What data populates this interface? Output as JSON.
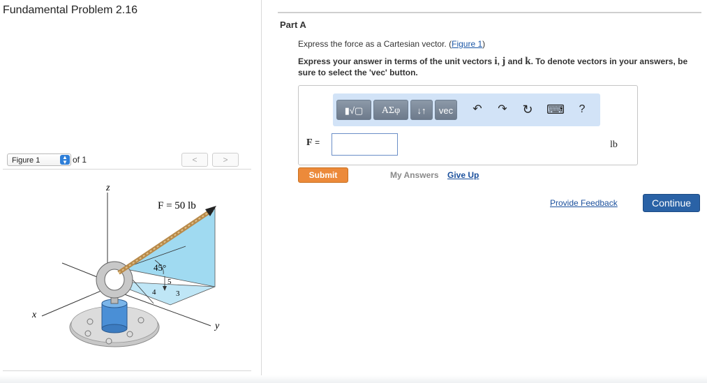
{
  "problem": {
    "title": "Fundamental Problem 2.16"
  },
  "figure_nav": {
    "select_value": "Figure 1",
    "of_label": "of 1",
    "prev": "<",
    "next": ">",
    "labels": {
      "z": "z",
      "x": "x",
      "y": "y",
      "force": "F = 50 lb",
      "angle": "45°",
      "n5": "5",
      "n4": "4",
      "n3": "3"
    }
  },
  "part": {
    "title": "Part A",
    "prompt_text": "Express the force as a Cartesian vector. (",
    "prompt_link": "Figure 1",
    "prompt_end": ")",
    "instr_pre": "Express your answer in terms of the unit vectors ",
    "unit_i": "i",
    "sep_comma": ", ",
    "unit_j": "j",
    "sep_and": " and ",
    "unit_k": "k",
    "instr_post": ". To denote vectors in your answers, be sure to select the 'vec' button."
  },
  "toolbar": {
    "templates": "▮√▢",
    "greek": "ΑΣφ",
    "arrows": "↓↑",
    "vec": "vec",
    "undo": "↶",
    "redo": "↷",
    "reset": "↻",
    "keyboard": "⌨",
    "help": "?"
  },
  "answer": {
    "label": "F",
    "equals": "=",
    "value": "",
    "unit": "lb"
  },
  "actions": {
    "submit": "Submit",
    "my_answers": "My Answers",
    "give_up": "Give Up",
    "feedback": "Provide Feedback",
    "continue": "Continue"
  },
  "colors": {
    "submit": "#ec8a3a",
    "continue": "#2a62a6",
    "toolbar": "#d2e3f7",
    "link": "#1a4f9c"
  }
}
